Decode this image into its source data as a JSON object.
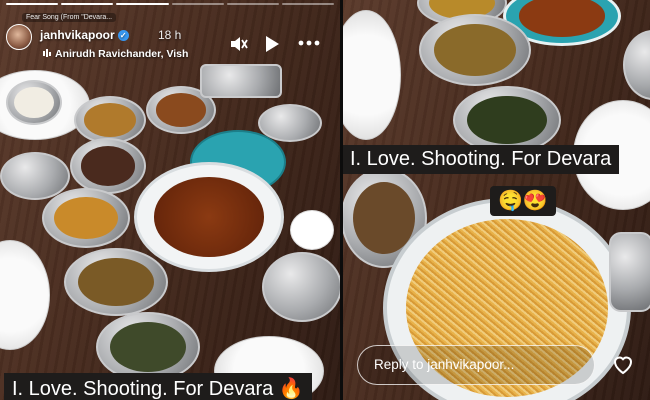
{
  "story": {
    "song_chip": "Fear Song (From \"Devara...",
    "username": "janhvikapoor",
    "verified_mark": "✓",
    "time_ago": "18 h",
    "music_label": "Anirudh Ravichander, Vish",
    "caption_left": "I. Love. Shooting. For Devara 🔥",
    "caption_right": "I. Love. Shooting. For Devara",
    "emojis": "🤤😍",
    "reply_placeholder": "Reply to janhvikapoor...",
    "progress_segments": 6,
    "progress_done": 3
  },
  "colors": {
    "table": "#4a2e22",
    "caption_bg": "#1e1c1b",
    "verified": "#3897f0",
    "teal_bowl": "#2aa3b0"
  },
  "icons": [
    "music-note-icon",
    "mute-icon",
    "play-icon",
    "more-icon",
    "heart-icon",
    "verified-icon"
  ]
}
